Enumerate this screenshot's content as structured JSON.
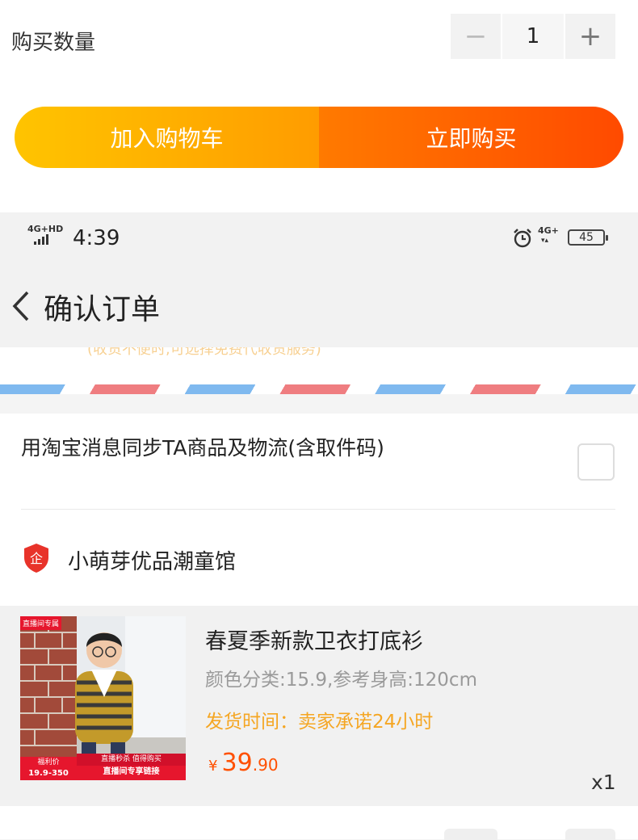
{
  "sku_panel": {
    "quantity_label": "购买数量",
    "quantity_value": "1",
    "minus_symbol": "−",
    "plus_symbol": "+",
    "add_to_cart_label": "加入购物车",
    "buy_now_label": "立即购买"
  },
  "status_bar": {
    "network_left": "4G+HD",
    "time": "4:39",
    "network_right": "4G+",
    "battery": "45"
  },
  "nav": {
    "back_icon": "chevron-left-icon",
    "title": "确认订单"
  },
  "address_hint": "(收货不便时,可选择免费代收货服务)",
  "sync_option": {
    "text": "用淘宝消息同步TA商品及物流(含取件码)",
    "checked": false
  },
  "shop": {
    "icon": "enterprise-shield-icon",
    "icon_glyph": "企",
    "name": "小萌芽优品潮童馆"
  },
  "item": {
    "badge_top": "直播间专属",
    "badge_left_line1": "福利价",
    "badge_left_line2": "19.9-350",
    "banner_line1": "直播秒杀 值得购买",
    "banner_line2": "直播间专享链接",
    "title": "春夏季新款卫衣打底衫",
    "spec": "颜色分类:15.9,参考身高:120cm",
    "shipping": "发货时间：卖家承诺24小时",
    "price_currency": "¥",
    "price_integer": "39",
    "price_decimal": ".90",
    "quantity": "x1"
  },
  "colors": {
    "accent_orange": "#ff5000",
    "cart_gradient_start": "#ffc400",
    "buy_gradient_end": "#ff4a00",
    "shipping_text": "#f5a623"
  }
}
